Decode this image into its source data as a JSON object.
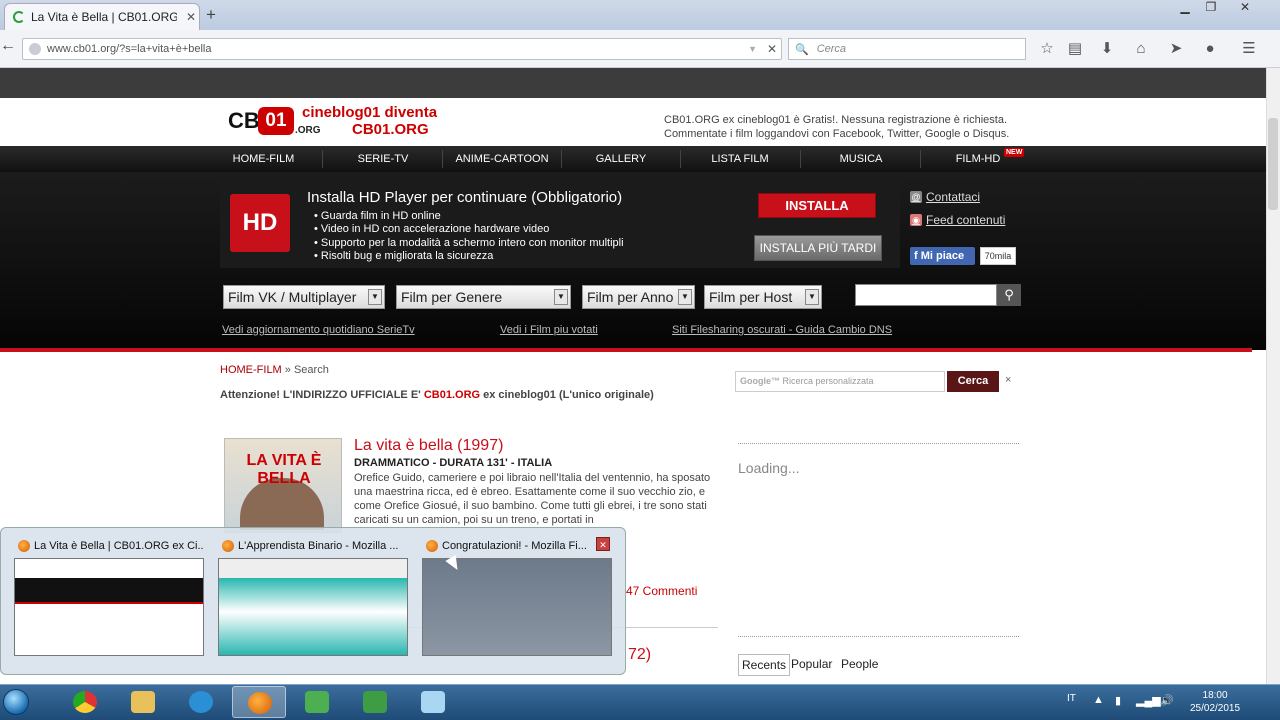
{
  "browser": {
    "tab_title": "La Vita è Bella | CB01.ORG ...",
    "new_tab": "+",
    "url": "www.cb01.org/?s=la+vita+è+bella",
    "search_placeholder": "Cerca"
  },
  "site": {
    "logo_cb": "CB",
    "logo_01": "01",
    "logo_org": ".ORG",
    "logo_line1": "cineblog01 diventa",
    "logo_line2": "CB01.ORG",
    "header_note_1": "CB01.ORG ex cineblog01 è Gratis!. Nessuna registrazione è richiesta.",
    "header_note_2": "Commentate i film loggandovi con Facebook, Twitter, Google o Disqus.",
    "menu": [
      "HOME-FILM",
      "SERIE-TV",
      "ANIME-CARTOON",
      "GALLERY",
      "LISTA FILM",
      "MUSICA",
      "FILM-HD"
    ],
    "new_badge": "NEW",
    "promo": {
      "badge": "HD",
      "title": "Installa HD Player per continuare (Obbligatorio)",
      "bullets": [
        "• Guarda film in HD online",
        "• Video in HD con accelerazione hardware video",
        "• Supporto per la modalità a schermo intero con monitor multipli",
        "• Risolti bug e migliorata la sicurezza"
      ],
      "install": "INSTALLA",
      "later": "INSTALLA PIÙ TARDI"
    },
    "side": {
      "contact": "Contattaci",
      "feed": "Feed contenuti",
      "like": "Mi piace",
      "like_count": "70mila"
    },
    "selects": [
      "Film VK  /  Multiplayer",
      "Film per Genere",
      "Film per Anno",
      "Film per Host"
    ],
    "links": [
      "Vedi aggiornamento quotidiano SerieTv",
      "Vedi i Film piu votati",
      "Siti Filesharing oscurati - Guida Cambio DNS"
    ]
  },
  "content": {
    "crumb_home": "HOME-FILM",
    "crumb_rest": " » Search",
    "notice_1": "Attenzione! L'INDIRIZZO UFFICIALE E' ",
    "notice_red": "CB01.ORG",
    "notice_2": " ex cineblog01 (L'unico originale)",
    "poster_text": "LA VITA È BELLA",
    "movie_title": "La vita è bella (1997)",
    "movie_meta": "DRAMMATICO - DURATA 131' - ITALIA",
    "movie_desc": "Orefice Guido, cameriere e poi libraio nell'Italia del ventennio, ha sposato una maestrina ricca, ed è ebreo. Esattamente come il suo vecchio zio, e come Orefice Giosué, il suo bambino. Come tutti gli ebrei, i tre sono stati caricati su un camion, poi su un treno, e portati in",
    "comments": "47 Commenti",
    "movie2_title_tail": "72)"
  },
  "right": {
    "gsearch_logo": "Google™",
    "gsearch_placeholder": "Ricerca personalizzata",
    "gsearch_button": "Cerca",
    "gsearch_x": "×",
    "loading": "Loading...",
    "tabs": [
      "Recents",
      "Popular",
      "People"
    ]
  },
  "preview": {
    "items": [
      "La Vita è Bella | CB01.ORG ex Ci...",
      "L'Apprendista Binario - Mozilla ...",
      "Congratulazioni! - Mozilla Fi..."
    ]
  },
  "taskbar": {
    "lang": "IT",
    "time": "18:00",
    "date": "25/02/2015"
  }
}
